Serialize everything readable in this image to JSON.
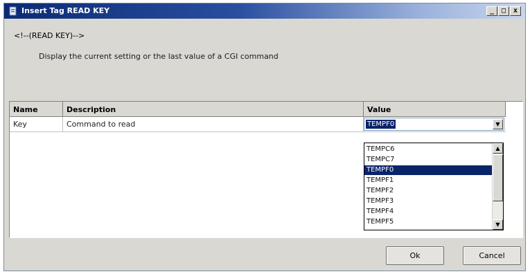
{
  "window": {
    "title": "Insert Tag READ KEY",
    "controls": {
      "minimize": "_",
      "maximize": "□",
      "close": "x"
    }
  },
  "tag_code": "<!--(READ KEY)-->",
  "description": "Display the current setting or the last value of a CGI command",
  "grid": {
    "headers": {
      "name": "Name",
      "description": "Description",
      "value": "Value"
    },
    "rows": [
      {
        "name": "Key",
        "description": "Command to read",
        "value": "TEMPF0"
      }
    ]
  },
  "dropdown": {
    "options": [
      "TEMPC6",
      "TEMPC7",
      "TEMPF0",
      "TEMPF1",
      "TEMPF2",
      "TEMPF3",
      "TEMPF4",
      "TEMPF5"
    ],
    "selected": "TEMPF0"
  },
  "buttons": {
    "ok": "Ok",
    "cancel": "Cancel"
  },
  "icons": {
    "title": "tag-icon",
    "combo": "dropdown-arrow-icon",
    "scroll_up": "arrow-up-icon",
    "scroll_down": "arrow-down-icon"
  }
}
